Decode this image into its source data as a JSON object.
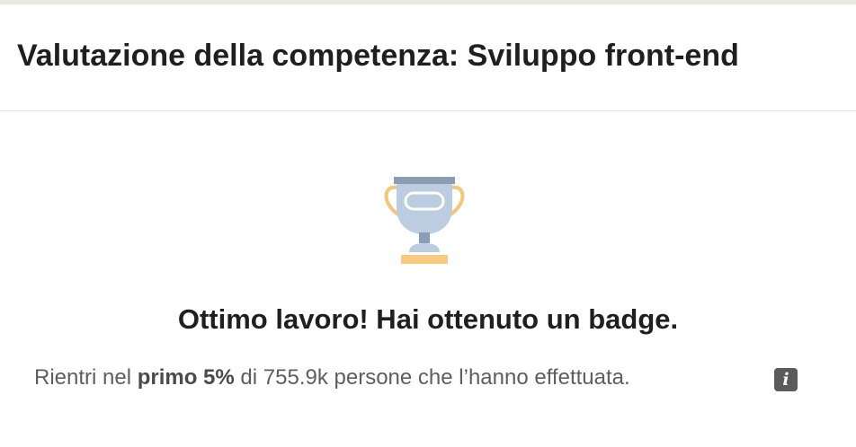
{
  "header": {
    "title": "Valutazione della competenza: Sviluppo front-end"
  },
  "result": {
    "badge_icon": "trophy-icon",
    "heading": "Ottimo lavoro! Hai ottenuto un badge.",
    "stat_prefix": "Rientri nel",
    "stat_highlight": "primo 5%",
    "stat_middle": "di",
    "stat_count": "755.9k",
    "stat_suffix": "persone che l’hanno effettuata.",
    "info_icon": "info-icon",
    "info_glyph": "i"
  },
  "colors": {
    "trophy_cup": "#bccde2",
    "trophy_rim": "#8a9db4",
    "trophy_handles": "#f0c878",
    "trophy_base": "#f6ca7f",
    "text_primary": "#1f1f1f",
    "text_secondary": "#5e5e5e"
  }
}
